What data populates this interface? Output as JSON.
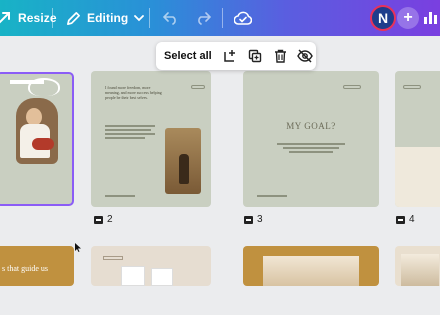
{
  "topbar": {
    "resize_label": "Resize",
    "editing_label": "Editing",
    "avatar_letter": "N",
    "add_label": "+"
  },
  "selection_toolbar": {
    "select_all_label": "Select all"
  },
  "pages": [
    {
      "number": "",
      "headline": ""
    },
    {
      "number": "2",
      "headline": "I found more freedom, more meaning, and more success helping people be their best selves."
    },
    {
      "number": "3",
      "headline": "MY GOAL?"
    },
    {
      "number": "4",
      "headline": ""
    }
  ],
  "bottom_row": {
    "tile1_text": "s that guide us"
  },
  "colors": {
    "accent_gradient_start": "#18b3c6",
    "accent_gradient_end": "#7a3fe0",
    "selected_border": "#8b5cf6",
    "sage": "#c9cfc1",
    "mustard": "#c0913f"
  }
}
